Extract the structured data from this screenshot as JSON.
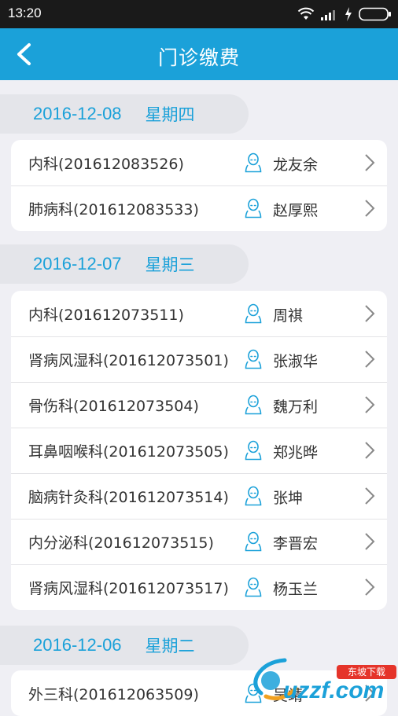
{
  "status_bar": {
    "time": "13:20"
  },
  "header": {
    "title": "门诊缴费"
  },
  "groups": [
    {
      "date": "2016-12-08",
      "weekday": "星期四",
      "items": [
        {
          "dept": "内科(201612083526)",
          "doctor": "龙友余"
        },
        {
          "dept": "肺病科(201612083533)",
          "doctor": "赵厚熙"
        }
      ]
    },
    {
      "date": "2016-12-07",
      "weekday": "星期三",
      "items": [
        {
          "dept": "内科(201612073511)",
          "doctor": "周祺"
        },
        {
          "dept": "肾病风湿科(201612073501)",
          "doctor": "张淑华"
        },
        {
          "dept": "骨伤科(201612073504)",
          "doctor": "魏万利"
        },
        {
          "dept": "耳鼻咽喉科(201612073505)",
          "doctor": "郑兆晔"
        },
        {
          "dept": "脑病针灸科(201612073514)",
          "doctor": "张坤"
        },
        {
          "dept": "内分泌科(201612073515)",
          "doctor": "李晋宏"
        },
        {
          "dept": "肾病风湿科(201612073517)",
          "doctor": "杨玉兰"
        }
      ]
    },
    {
      "date": "2016-12-06",
      "weekday": "星期二",
      "items": [
        {
          "dept": "外三科(201612063509)",
          "doctor": "吴靖"
        }
      ]
    }
  ],
  "watermark": {
    "text": "uzzf.com",
    "badge": "东坡下载"
  },
  "colors": {
    "accent": "#1ba1d9",
    "background": "#efeff4",
    "status_bar": "#1a1a1a"
  }
}
